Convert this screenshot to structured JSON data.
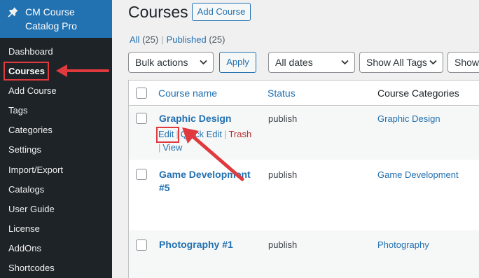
{
  "sidebar": {
    "plugin_title": "CM Course Catalog Pro",
    "items": [
      {
        "label": "Dashboard"
      },
      {
        "label": "Courses"
      },
      {
        "label": "Add Course"
      },
      {
        "label": "Tags"
      },
      {
        "label": "Categories"
      },
      {
        "label": "Settings"
      },
      {
        "label": "Import/Export"
      },
      {
        "label": "Catalogs"
      },
      {
        "label": "User Guide"
      },
      {
        "label": "License"
      },
      {
        "label": "AddOns"
      },
      {
        "label": "Shortcodes"
      }
    ],
    "current": "Courses"
  },
  "header": {
    "title": "Courses",
    "add_label": "Add Course"
  },
  "filters": {
    "all_label": "All",
    "all_count": "(25)",
    "published_label": "Published",
    "published_count": "(25)",
    "bulk_actions": "Bulk actions",
    "apply": "Apply",
    "dates": "All dates",
    "tags": "Show All Tags",
    "show": "Show"
  },
  "table": {
    "columns": [
      "Course name",
      "Status",
      "Course Categories"
    ],
    "rows": [
      {
        "title": "Graphic Design",
        "status": "publish",
        "category": "Graphic Design"
      },
      {
        "title": "Game Development #5",
        "status": "publish",
        "category": "Game Development"
      },
      {
        "title": "Photography #1",
        "status": "publish",
        "category": "Photography"
      }
    ],
    "row_actions": {
      "edit": "Edit",
      "quick_edit": "Quick Edit",
      "trash": "Trash",
      "view": "View",
      "separator": "|"
    }
  },
  "colors": {
    "accent": "#2271b1",
    "sidebar_bg": "#1d2327",
    "highlight": "#e03a3e",
    "trash": "#b32d2e"
  },
  "icons": {
    "plugin": "pin-icon",
    "select": "chevron-down-icon",
    "annotation": "arrow-icon"
  }
}
